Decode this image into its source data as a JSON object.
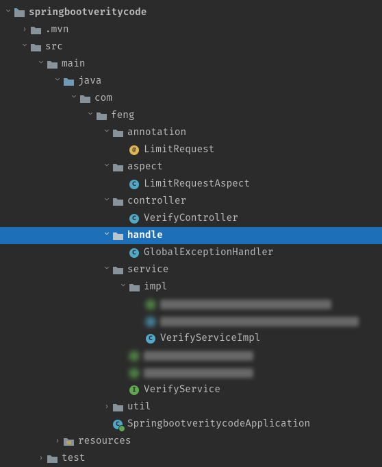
{
  "root": "springbootveritycode",
  "mvn": ".mvn",
  "src": "src",
  "main": "main",
  "java": "java",
  "com": "com",
  "feng": "feng",
  "annotation": "annotation",
  "limitRequest": "LimitRequest",
  "aspect": "aspect",
  "limitRequestAspect": "LimitRequestAspect",
  "controller": "controller",
  "verifyController": "VerifyController",
  "handle": "handle",
  "globalExceptionHandler": "GlobalExceptionHandler",
  "service": "service",
  "impl": "impl",
  "verifyServiceImpl": "VerifyServiceImpl",
  "verifyService": "VerifyService",
  "util": "util",
  "app": "SpringbootveritycodeApplication",
  "resources": "resources",
  "test": "test"
}
